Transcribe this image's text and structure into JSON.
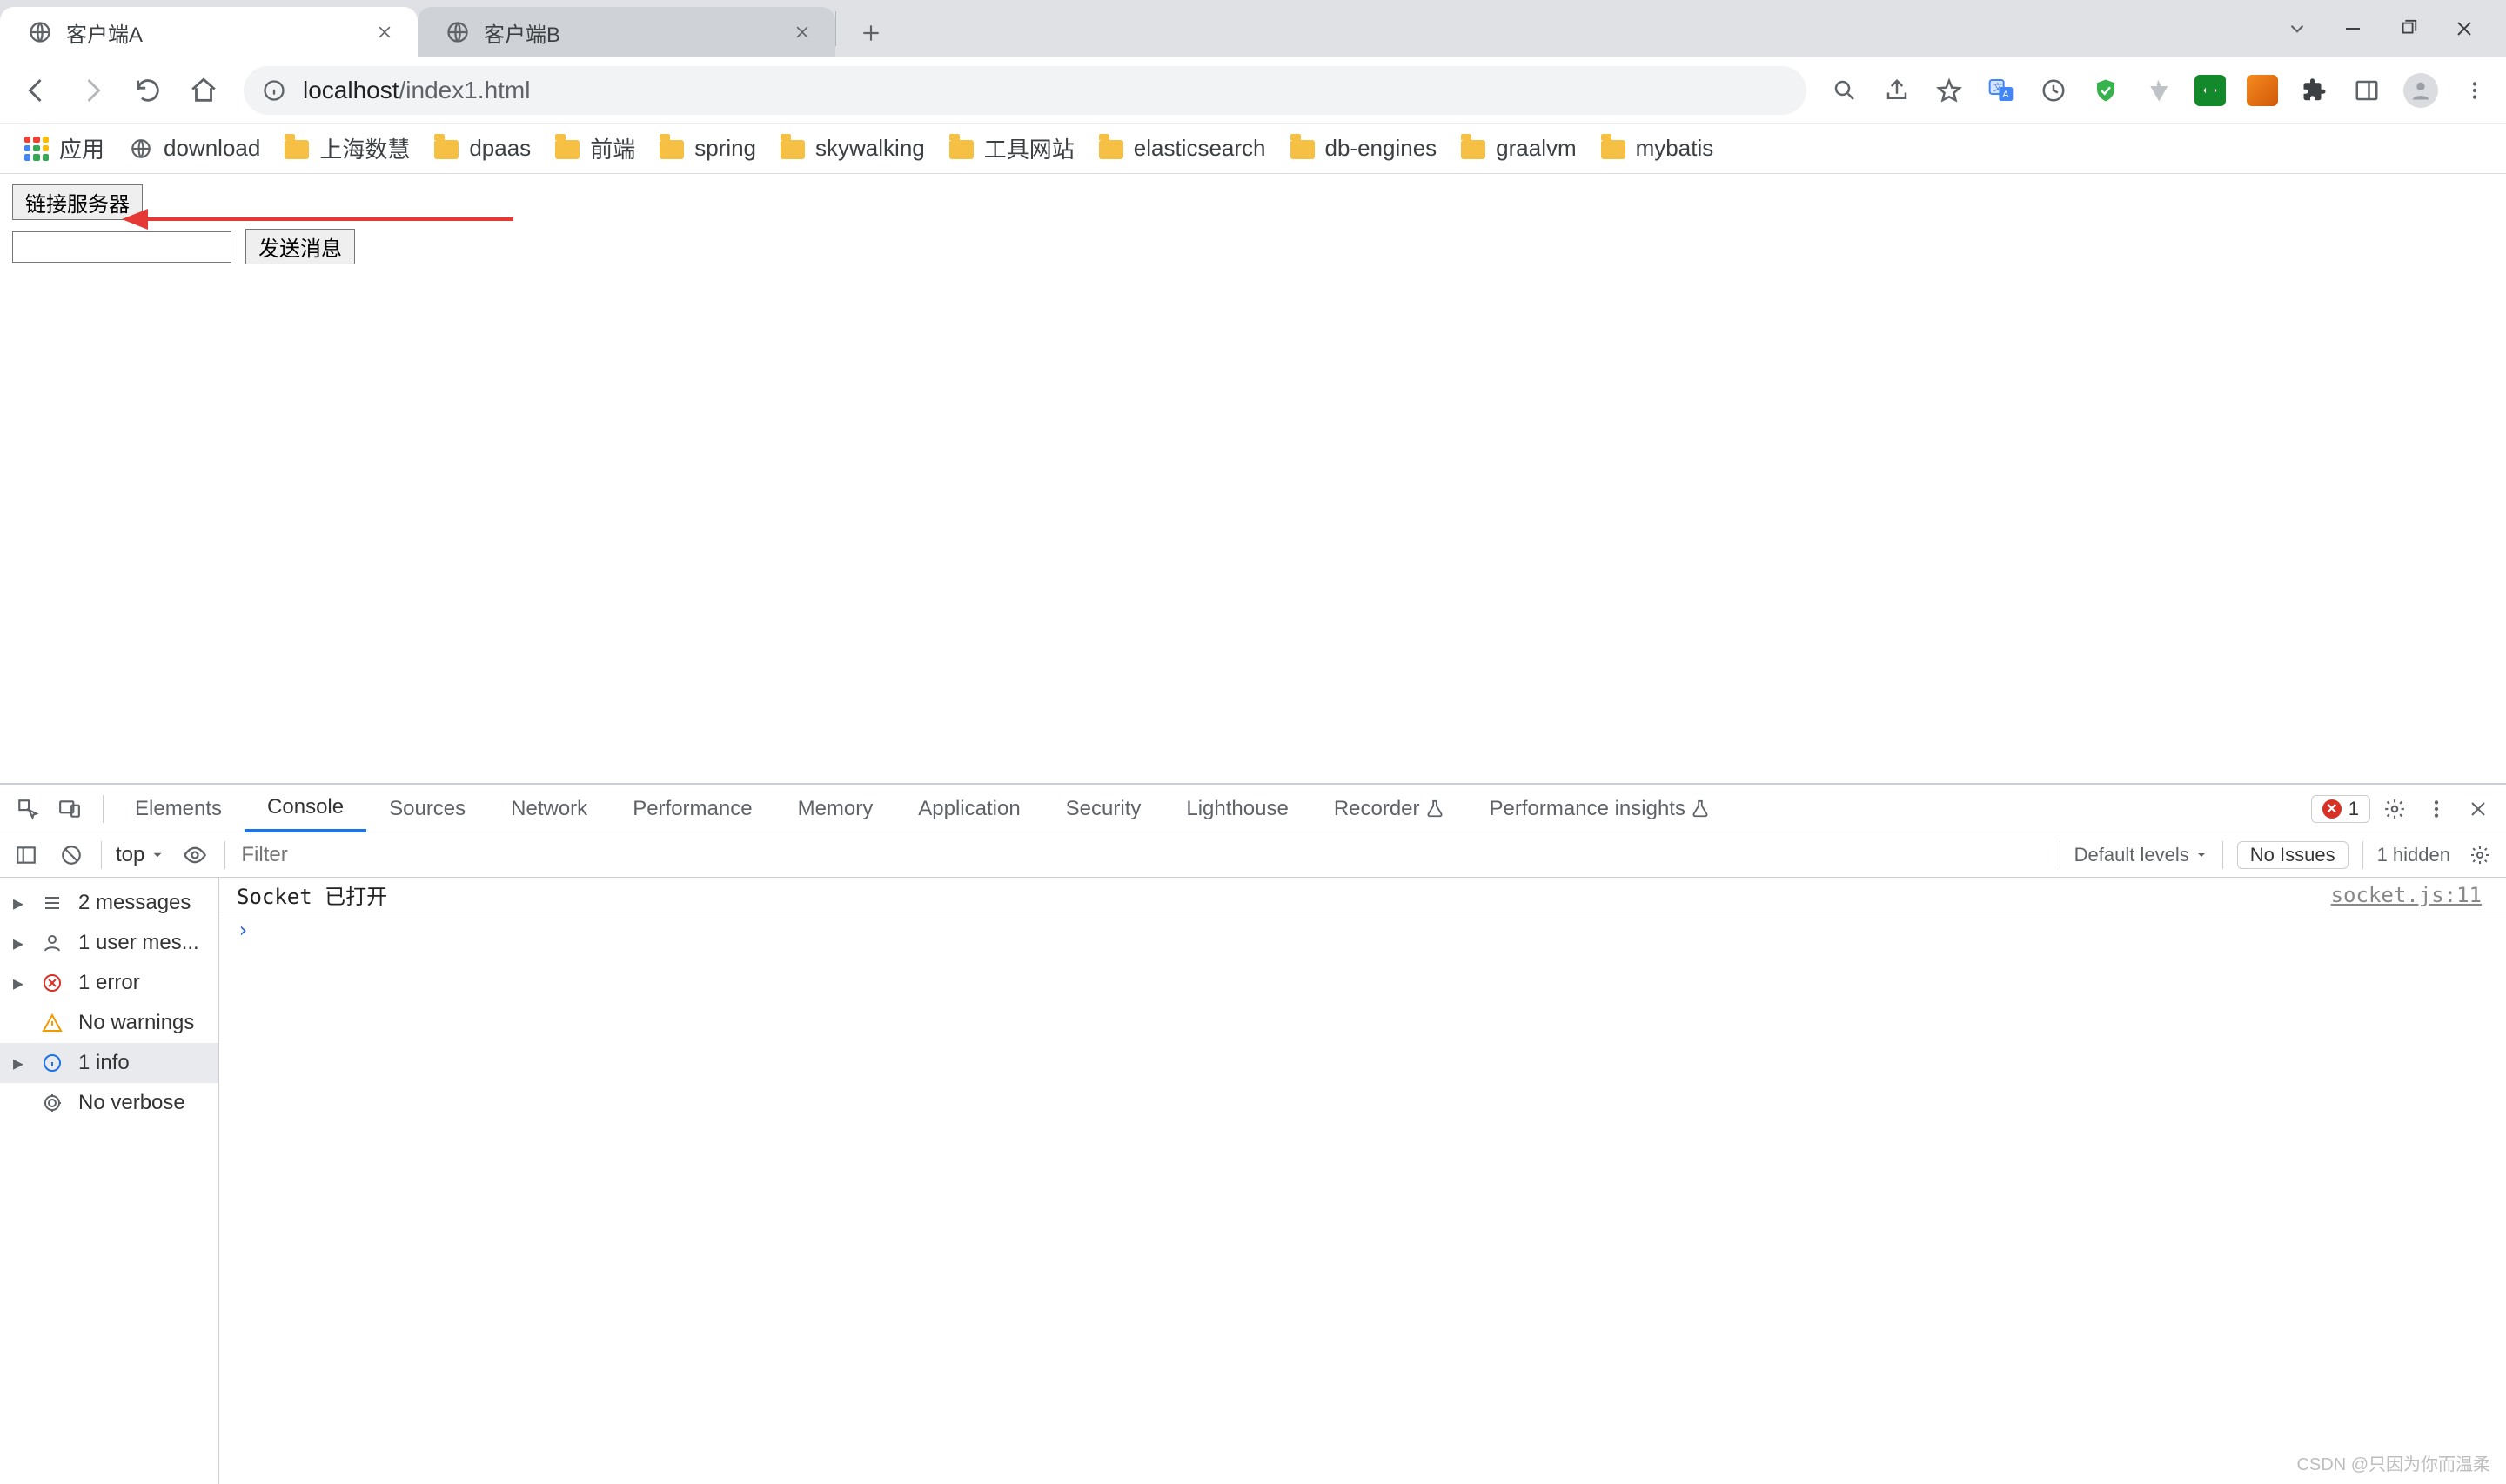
{
  "tabs": [
    {
      "title": "客户端A",
      "active": true
    },
    {
      "title": "客户端B",
      "active": false
    }
  ],
  "window": {
    "chevron": "⌄",
    "minimize": "−",
    "maximize": "❐",
    "close": "✕"
  },
  "omnibox": {
    "url": "localhost/index1.html",
    "host": "localhost",
    "path": "/index1.html"
  },
  "toolbar_icons": {
    "search": "search",
    "share": "share",
    "star": "star",
    "translate": "translate",
    "clock": "clock",
    "shield": "shield",
    "paperclip": "paperclip",
    "ext_green": "extension",
    "ext_orange": "extension",
    "puzzle": "puzzle",
    "sidepanel": "sidepanel",
    "avatar": "avatar",
    "menu": "menu"
  },
  "bookmarks": {
    "apps_label": "应用",
    "items": [
      {
        "type": "globe",
        "label": "download"
      },
      {
        "type": "folder",
        "label": "上海数慧"
      },
      {
        "type": "folder",
        "label": "dpaas"
      },
      {
        "type": "folder",
        "label": "前端"
      },
      {
        "type": "folder",
        "label": "spring"
      },
      {
        "type": "folder",
        "label": "skywalking"
      },
      {
        "type": "folder",
        "label": "工具网站"
      },
      {
        "type": "folder",
        "label": "elasticsearch"
      },
      {
        "type": "folder",
        "label": "db-engines"
      },
      {
        "type": "folder",
        "label": "graalvm"
      },
      {
        "type": "folder",
        "label": "mybatis"
      }
    ]
  },
  "page": {
    "connect_button": "链接服务器",
    "send_button": "发送消息",
    "input_value": ""
  },
  "devtools": {
    "tabs": [
      "Elements",
      "Console",
      "Sources",
      "Network",
      "Performance",
      "Memory",
      "Application",
      "Security",
      "Lighthouse",
      "Recorder",
      "Performance insights"
    ],
    "active_tab": "Console",
    "error_count": "1",
    "sub": {
      "context": "top",
      "eye": "eye",
      "filter_placeholder": "Filter",
      "levels_label": "Default levels",
      "no_issues": "No Issues",
      "hidden": "1 hidden"
    },
    "sidebar": [
      {
        "icon": "list",
        "label": "2 messages",
        "caret": true
      },
      {
        "icon": "user",
        "label": "1 user mes...",
        "caret": true
      },
      {
        "icon": "error",
        "label": "1 error",
        "caret": true
      },
      {
        "icon": "warn",
        "label": "No warnings",
        "caret": false
      },
      {
        "icon": "info",
        "label": "1 info",
        "caret": true,
        "selected": true
      },
      {
        "icon": "verbose",
        "label": "No verbose",
        "caret": false
      }
    ],
    "console_line": {
      "msg": "Socket 已打开",
      "src": "socket.js:11"
    },
    "prompt": ">"
  },
  "watermark": "CSDN @只因为你而温柔"
}
